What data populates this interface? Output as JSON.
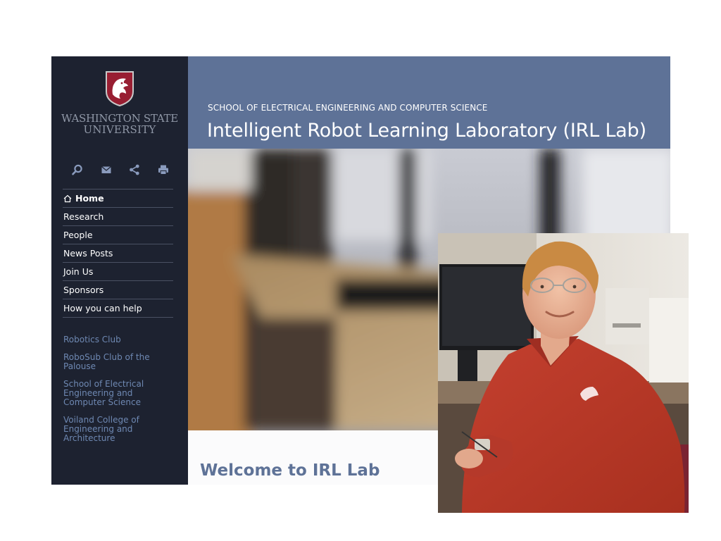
{
  "brand": {
    "logo_icon": "wsu-cougar-shield-icon",
    "name_line1": "WASHINGTON STATE",
    "name_line2": "UNIVERSITY",
    "crimson": "#981e32"
  },
  "toolbar": {
    "icons": [
      "search-icon",
      "email-icon",
      "share-icon",
      "print-icon"
    ]
  },
  "nav": {
    "items": [
      {
        "label": "Home",
        "icon": "home-icon",
        "active": true
      },
      {
        "label": "Research"
      },
      {
        "label": "People"
      },
      {
        "label": "News Posts"
      },
      {
        "label": "Join Us"
      },
      {
        "label": "Sponsors"
      },
      {
        "label": "How you can help"
      }
    ]
  },
  "related_links": [
    "Robotics Club",
    "RoboSub Club of the Palouse",
    "School of Electrical Engineering and Computer Science",
    "Voiland College of Engineering and Architecture"
  ],
  "header": {
    "school": "SCHOOL OF ELECTRICAL ENGINEERING AND COMPUTER SCIENCE",
    "title": "Intelligent Robot Learning Laboratory (IRL Lab)"
  },
  "main": {
    "welcome": "Welcome to IRL Lab"
  },
  "colors": {
    "sidebar_bg": "#1d2230",
    "header_bg": "#5e7297",
    "link": "#6e88b2",
    "shirt": "#c0392b"
  }
}
